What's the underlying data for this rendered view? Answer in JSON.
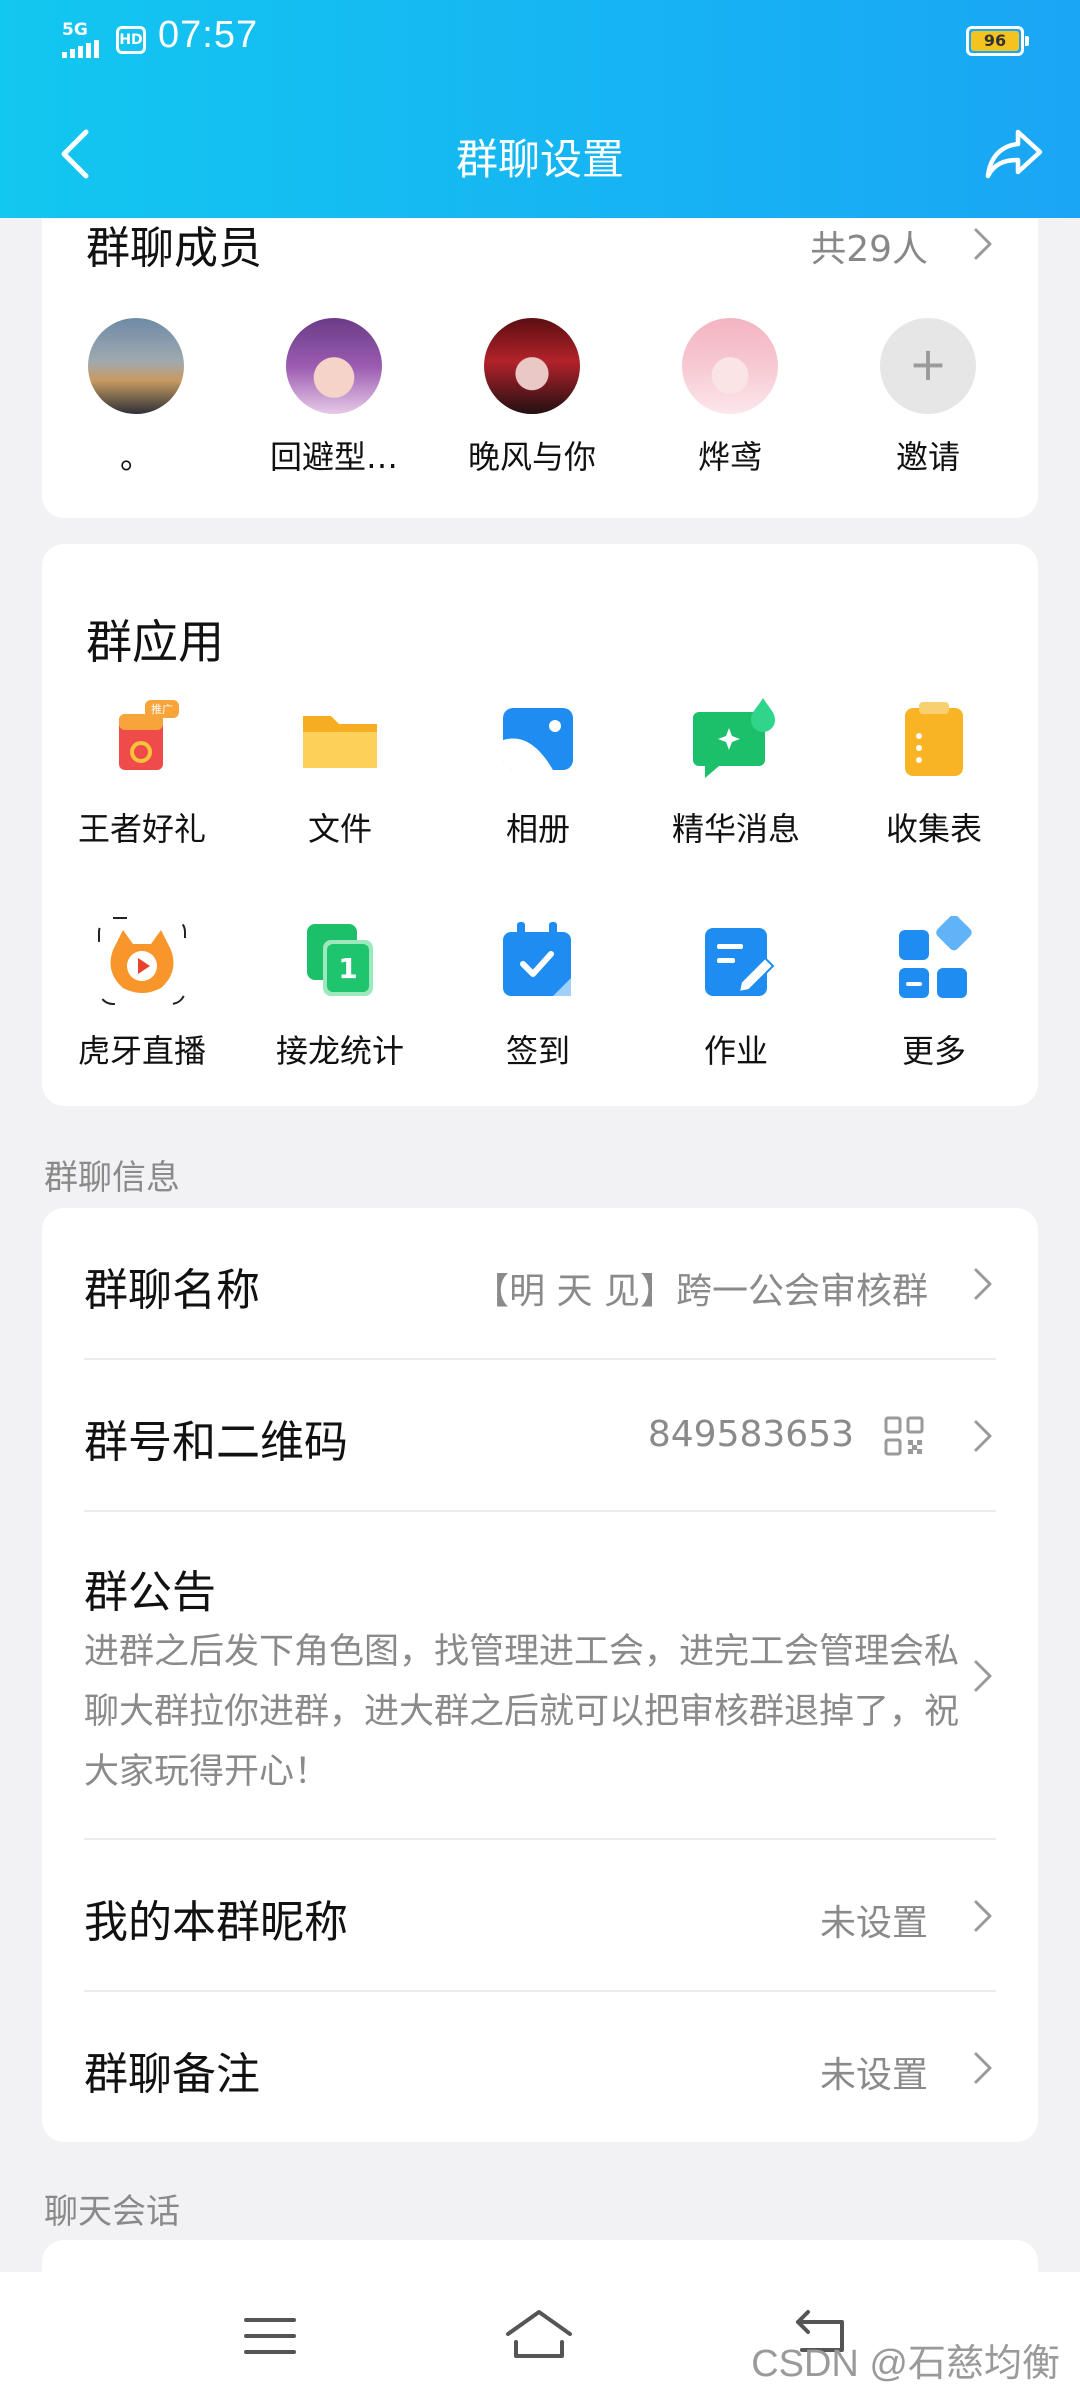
{
  "status_bar": {
    "network": "5G",
    "hd": "HD",
    "time": "07:57",
    "battery": "96"
  },
  "header": {
    "title": "群聊设置"
  },
  "members": {
    "title": "群聊成员",
    "count": "共29人",
    "list": [
      {
        "name": "。"
      },
      {
        "name": "回避型…"
      },
      {
        "name": "晚风与你"
      },
      {
        "name": "烨鸢"
      },
      {
        "name": "邀请"
      }
    ],
    "invite_symbol": "+"
  },
  "apps": {
    "title": "群应用",
    "items": [
      {
        "label": "王者好礼",
        "badge": "推广"
      },
      {
        "label": "文件"
      },
      {
        "label": "相册"
      },
      {
        "label": "精华消息"
      },
      {
        "label": "收集表"
      },
      {
        "label": "虎牙直播"
      },
      {
        "label": "接龙统计",
        "badge": "1"
      },
      {
        "label": "签到"
      },
      {
        "label": "作业"
      },
      {
        "label": "更多"
      }
    ]
  },
  "info": {
    "section_label": "群聊信息",
    "name_label": "群聊名称",
    "name_value": "【明 天 见】跨一公会审核群",
    "id_label": "群号和二维码",
    "id_value": "849583653",
    "notice_label": "群公告",
    "notice_text": "进群之后发下角色图，找管理进工会，进完工会管理会私聊大群拉你进群，进大群之后就可以把审核群退掉了，祝大家玩得开心！",
    "nickname_label": "我的本群昵称",
    "nickname_value": "未设置",
    "remark_label": "群聊备注",
    "remark_value": "未设置"
  },
  "chat": {
    "section_label": "聊天会话"
  },
  "watermark": "CSDN @石慈均衡",
  "colors": {
    "header_start": "#12c7f0",
    "header_end": "#1aa6f5",
    "page_bg": "#f2f2f5",
    "battery": "#f5c320"
  }
}
